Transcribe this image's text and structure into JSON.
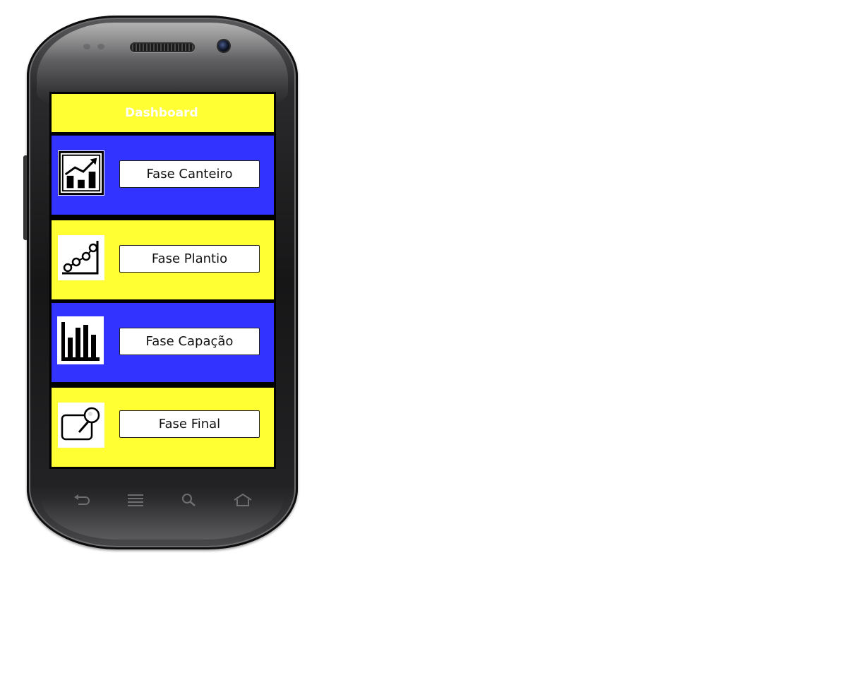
{
  "app": {
    "header_title": "Dashboard"
  },
  "tiles": [
    {
      "label": "Fase Canteiro",
      "icon": "trending-up-chart-icon",
      "color": "#3333ff"
    },
    {
      "label": "Fase Plantio",
      "icon": "line-graph-icon",
      "color": "#ffff33"
    },
    {
      "label": "Fase Capação",
      "icon": "bar-chart-icon",
      "color": "#3333ff"
    },
    {
      "label": "Fase Final",
      "icon": "pin-note-icon",
      "color": "#ffff33"
    }
  ],
  "navbar": {
    "keys": [
      "back-icon",
      "menu-icon",
      "search-icon",
      "home-icon"
    ]
  },
  "colors": {
    "header_bg": "#ffff33",
    "header_text": "#ffffff",
    "blue_tile": "#3333ff",
    "yellow_tile": "#ffff33"
  }
}
